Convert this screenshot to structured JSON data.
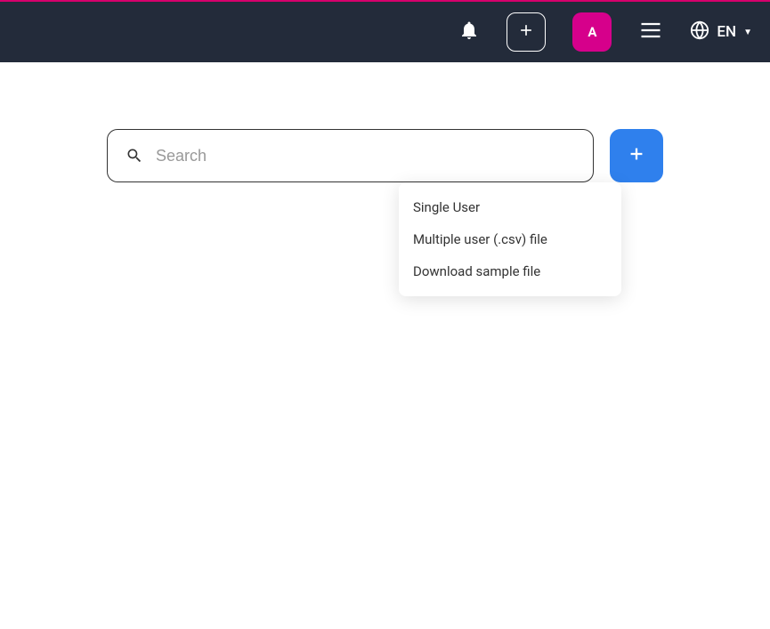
{
  "header": {
    "avatar_letter": "A",
    "language": "EN"
  },
  "search": {
    "placeholder": "Search"
  },
  "dropdown": {
    "items": [
      "Single User",
      "Multiple user (.csv) file",
      "Download sample file"
    ]
  }
}
